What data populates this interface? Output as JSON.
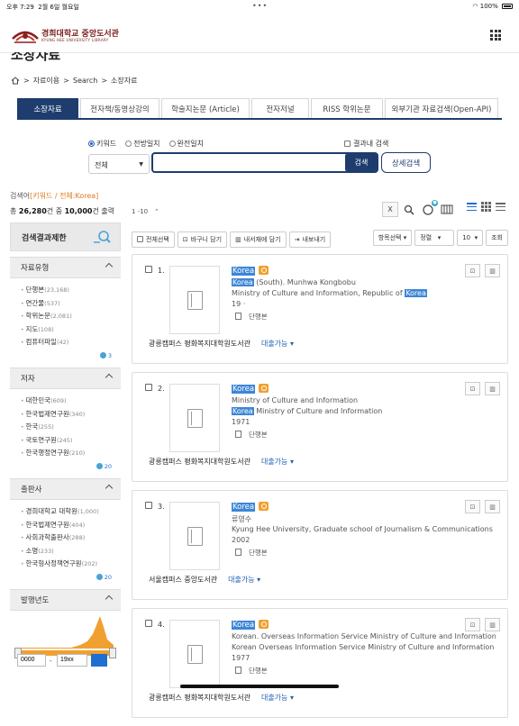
{
  "statusbar": {
    "time": "오후 7:29",
    "date": "2월 6일 월요일",
    "dots": "•••",
    "battery": "100%"
  },
  "header": {
    "logo_title": "경희대학교 중앙도서관",
    "logo_sub": "KYUNG HEE UNIVERSITY LIBRARY"
  },
  "page_title": "소장자료",
  "breadcrumb": {
    "items": [
      "자료이용",
      "Search",
      "소장자료"
    ]
  },
  "tabs": [
    {
      "label": "소장자료",
      "active": true
    },
    {
      "label": "전자책/동영상강의"
    },
    {
      "label": "학술지논문 (Article)"
    },
    {
      "label": "전자저널"
    },
    {
      "label": "RISS 학위논문"
    },
    {
      "label": "외부기관 자료검색(Open-API)"
    }
  ],
  "search": {
    "options": [
      "키워드",
      "전방일치",
      "완전일치"
    ],
    "selected_option": "키워드",
    "within_label": "결과내 검색",
    "field_value": "전체",
    "query": "",
    "button_label": "검색",
    "advanced_label": "상세검색"
  },
  "summary": {
    "query_prefix": "검색어",
    "query_text": "[키워드 / 전체:Korea]",
    "total_prefix": "총",
    "total_count": "26,280",
    "total_mid": "건 중",
    "shown_count": "10,000",
    "total_suffix": "건 출력",
    "range": "1 -10"
  },
  "sidebar": {
    "title": "검색결과제한",
    "facets": [
      {
        "title": "자료유형",
        "items": [
          {
            "label": "단행본",
            "count": "(23,168)"
          },
          {
            "label": "연간물",
            "count": "(537)"
          },
          {
            "label": "학위논문",
            "count": "(2,081)"
          },
          {
            "label": "지도",
            "count": "(108)"
          },
          {
            "label": "컴퓨터파일",
            "count": "(42)"
          }
        ],
        "more": "3"
      },
      {
        "title": "저자",
        "items": [
          {
            "label": "대한민국",
            "count": "(609)"
          },
          {
            "label": "한국법제연구원",
            "count": "(340)"
          },
          {
            "label": "한국",
            "count": "(255)"
          },
          {
            "label": "국토연구원",
            "count": "(245)"
          },
          {
            "label": "한국행정연구원",
            "count": "(210)"
          }
        ],
        "more": "20"
      },
      {
        "title": "출판사",
        "items": [
          {
            "label": "경희대학교 대학원",
            "count": "(1,000)"
          },
          {
            "label": "한국법제연구원",
            "count": "(404)"
          },
          {
            "label": "사회과학출판사",
            "count": "(288)"
          },
          {
            "label": "소명",
            "count": "(233)"
          },
          {
            "label": "한국형사정책연구원",
            "count": "(202)"
          }
        ],
        "more": "20"
      },
      {
        "title": "발행년도"
      }
    ],
    "year_from": "0000",
    "year_to": "19xx"
  },
  "toolbar": {
    "select_all": "전체선택",
    "cart": "바구니 담기",
    "shelf": "내서재에 담기",
    "export": "내보내기",
    "field_select": "항목선택",
    "sort": "정렬",
    "page_size": "10",
    "view": "조회"
  },
  "results": [
    {
      "num": "1.",
      "title": "Korea",
      "lines": [
        [
          {
            "t": "Korea",
            "h": true
          },
          {
            "t": " (South). Munhwa Kongbobu"
          }
        ],
        [
          {
            "t": "Ministry of Culture and Information, Republic of "
          },
          {
            "t": "Korea",
            "h": true
          }
        ],
        [
          {
            "t": "19 ·"
          }
        ]
      ],
      "type": "단행본",
      "location": "광릉캠퍼스 평화복지대학원도서관",
      "status": "대출가능"
    },
    {
      "num": "2.",
      "title": "Korea",
      "lines": [
        [
          {
            "t": "Ministry of Culture and Information"
          }
        ],
        [
          {
            "t": "Korea",
            "h": true
          },
          {
            "t": " Ministry of Culture and Information"
          }
        ],
        [
          {
            "t": "1971"
          }
        ]
      ],
      "type": "단행본",
      "location": "광릉캠퍼스 평화복지대학원도서관",
      "status": "대출가능"
    },
    {
      "num": "3.",
      "title": "Korea",
      "lines": [
        [
          {
            "t": "류영수"
          }
        ],
        [
          {
            "t": "Kyung Hee University, Graduate school of Journalism & Communications"
          }
        ],
        [
          {
            "t": "2002"
          }
        ]
      ],
      "type": "단행본",
      "location": "서울캠퍼스 중앙도서관",
      "status": "대출가능"
    },
    {
      "num": "4.",
      "title": "Korea",
      "lines": [
        [
          {
            "t": "Korean. Overseas Information Service Ministry of Culture and Information"
          }
        ],
        [
          {
            "t": "Korean Overseas Information Service Ministry of Culture and Information"
          }
        ],
        [
          {
            "t": "1977"
          }
        ]
      ],
      "type": "단행본",
      "location": "광릉캠퍼스 평화복지대학원도서관",
      "status": "대출가능"
    }
  ],
  "colors": {
    "primary": "#1e3d6e",
    "highlight": "#3d86d6",
    "accent": "#e07a1c",
    "link": "#1e5fb5"
  }
}
